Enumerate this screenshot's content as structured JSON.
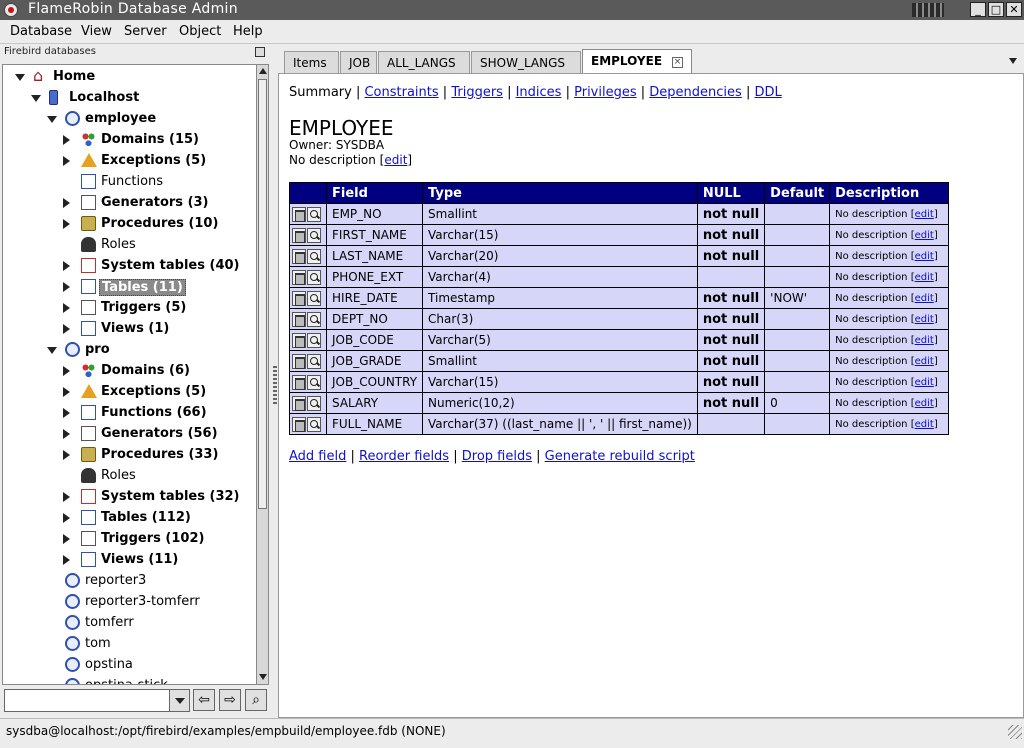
{
  "window": {
    "title": "FlameRobin Database Admin",
    "min": "_",
    "max": "□",
    "close": "✕"
  },
  "menu": [
    "Database",
    "View",
    "Server",
    "Object",
    "Help"
  ],
  "left_panel": {
    "title": "Firebird databases",
    "tree": [
      {
        "label": "Home",
        "icon": "home-icon",
        "bold": true,
        "expander": "open",
        "level": 0
      },
      {
        "label": "Localhost",
        "icon": "server-icon",
        "bold": true,
        "expander": "open",
        "level": 1
      },
      {
        "label": "employee",
        "icon": "database-icon",
        "bold": true,
        "expander": "open",
        "level": 2
      },
      {
        "label": "Domains (15)",
        "icon": "domains-icon",
        "bold": true,
        "expander": "closed",
        "level": 3
      },
      {
        "label": "Exceptions (5)",
        "icon": "exceptions-icon",
        "bold": true,
        "expander": "closed",
        "level": 3
      },
      {
        "label": "Functions",
        "icon": "functions-icon",
        "bold": false,
        "expander": "none",
        "level": 3
      },
      {
        "label": "Generators (3)",
        "icon": "generators-icon",
        "bold": true,
        "expander": "closed",
        "level": 3
      },
      {
        "label": "Procedures (10)",
        "icon": "procedures-icon",
        "bold": true,
        "expander": "closed",
        "level": 3
      },
      {
        "label": "Roles",
        "icon": "roles-icon",
        "bold": false,
        "expander": "none",
        "level": 3
      },
      {
        "label": "System tables (40)",
        "icon": "system-tables-icon",
        "bold": true,
        "expander": "closed",
        "level": 3
      },
      {
        "label": "Tables (11)",
        "icon": "tables-icon",
        "bold": true,
        "expander": "closed",
        "level": 3,
        "selected": true
      },
      {
        "label": "Triggers (5)",
        "icon": "triggers-icon",
        "bold": true,
        "expander": "closed",
        "level": 3
      },
      {
        "label": "Views (1)",
        "icon": "views-icon",
        "bold": true,
        "expander": "closed",
        "level": 3
      },
      {
        "label": "pro",
        "icon": "database-icon",
        "bold": true,
        "expander": "open",
        "level": 2
      },
      {
        "label": "Domains (6)",
        "icon": "domains-icon",
        "bold": true,
        "expander": "closed",
        "level": 3
      },
      {
        "label": "Exceptions (5)",
        "icon": "exceptions-icon",
        "bold": true,
        "expander": "closed",
        "level": 3
      },
      {
        "label": "Functions (66)",
        "icon": "functions-icon",
        "bold": true,
        "expander": "closed",
        "level": 3
      },
      {
        "label": "Generators (56)",
        "icon": "generators-icon",
        "bold": true,
        "expander": "closed",
        "level": 3
      },
      {
        "label": "Procedures (33)",
        "icon": "procedures-icon",
        "bold": true,
        "expander": "closed",
        "level": 3
      },
      {
        "label": "Roles",
        "icon": "roles-icon",
        "bold": false,
        "expander": "none",
        "level": 3
      },
      {
        "label": "System tables (32)",
        "icon": "system-tables-icon",
        "bold": true,
        "expander": "closed",
        "level": 3
      },
      {
        "label": "Tables (112)",
        "icon": "tables-icon",
        "bold": true,
        "expander": "closed",
        "level": 3
      },
      {
        "label": "Triggers (102)",
        "icon": "triggers-icon",
        "bold": true,
        "expander": "closed",
        "level": 3
      },
      {
        "label": "Views (11)",
        "icon": "views-icon",
        "bold": true,
        "expander": "closed",
        "level": 3
      },
      {
        "label": "reporter3",
        "icon": "database-icon",
        "bold": false,
        "expander": "none",
        "level": 2
      },
      {
        "label": "reporter3-tomferr",
        "icon": "database-icon",
        "bold": false,
        "expander": "none",
        "level": 2
      },
      {
        "label": "tomferr",
        "icon": "database-icon",
        "bold": false,
        "expander": "none",
        "level": 2
      },
      {
        "label": "tom",
        "icon": "database-icon",
        "bold": false,
        "expander": "none",
        "level": 2
      },
      {
        "label": "opstina",
        "icon": "database-icon",
        "bold": false,
        "expander": "none",
        "level": 2
      },
      {
        "label": "opstina-stick",
        "icon": "database-icon",
        "bold": false,
        "expander": "none",
        "level": 2
      }
    ],
    "search_value": "",
    "footer_buttons": [
      "back-arrow-icon",
      "forward-arrow-icon",
      "search-icon"
    ]
  },
  "tabs": [
    {
      "label": "Items",
      "active": false
    },
    {
      "label": "JOB",
      "active": false
    },
    {
      "label": "ALL_LANGS",
      "active": false
    },
    {
      "label": "SHOW_LANGS",
      "active": false
    },
    {
      "label": "EMPLOYEE",
      "active": true
    }
  ],
  "content": {
    "nav_current": "Summary",
    "nav_links": [
      "Constraints",
      "Triggers",
      "Indices",
      "Privileges",
      "Dependencies",
      "DDL"
    ],
    "title": "EMPLOYEE",
    "owner": "Owner: SYSDBA",
    "no_description": "No description",
    "edit": "edit",
    "columns": [
      "Field",
      "Type",
      "NULL",
      "Default",
      "Description"
    ],
    "rows": [
      {
        "field": "EMP_NO",
        "type": "Smallint",
        "null": "not null",
        "default": "",
        "desc": "No description"
      },
      {
        "field": "FIRST_NAME",
        "type": "Varchar(15)",
        "null": "not null",
        "default": "",
        "desc": "No description"
      },
      {
        "field": "LAST_NAME",
        "type": "Varchar(20)",
        "null": "not null",
        "default": "",
        "desc": "No description"
      },
      {
        "field": "PHONE_EXT",
        "type": "Varchar(4)",
        "null": "",
        "default": "",
        "desc": "No description"
      },
      {
        "field": "HIRE_DATE",
        "type": "Timestamp",
        "null": "not null",
        "default": "'NOW'",
        "desc": "No description"
      },
      {
        "field": "DEPT_NO",
        "type": "Char(3)",
        "null": "not null",
        "default": "",
        "desc": "No description"
      },
      {
        "field": "JOB_CODE",
        "type": "Varchar(5)",
        "null": "not null",
        "default": "",
        "desc": "No description"
      },
      {
        "field": "JOB_GRADE",
        "type": "Smallint",
        "null": "not null",
        "default": "",
        "desc": "No description"
      },
      {
        "field": "JOB_COUNTRY",
        "type": "Varchar(15)",
        "null": "not null",
        "default": "",
        "desc": "No description"
      },
      {
        "field": "SALARY",
        "type": "Numeric(10,2)",
        "null": "not null",
        "default": "0",
        "desc": "No description"
      },
      {
        "field": "FULL_NAME",
        "type": "Varchar(37) ((last_name || ', ' || first_name))",
        "null": "",
        "default": "",
        "desc": "No description"
      }
    ],
    "actions": [
      "Add field",
      "Reorder fields",
      "Drop fields",
      "Generate rebuild script"
    ]
  },
  "status": "sysdba@localhost:/opt/firebird/examples/empbuild/employee.fdb (NONE)"
}
